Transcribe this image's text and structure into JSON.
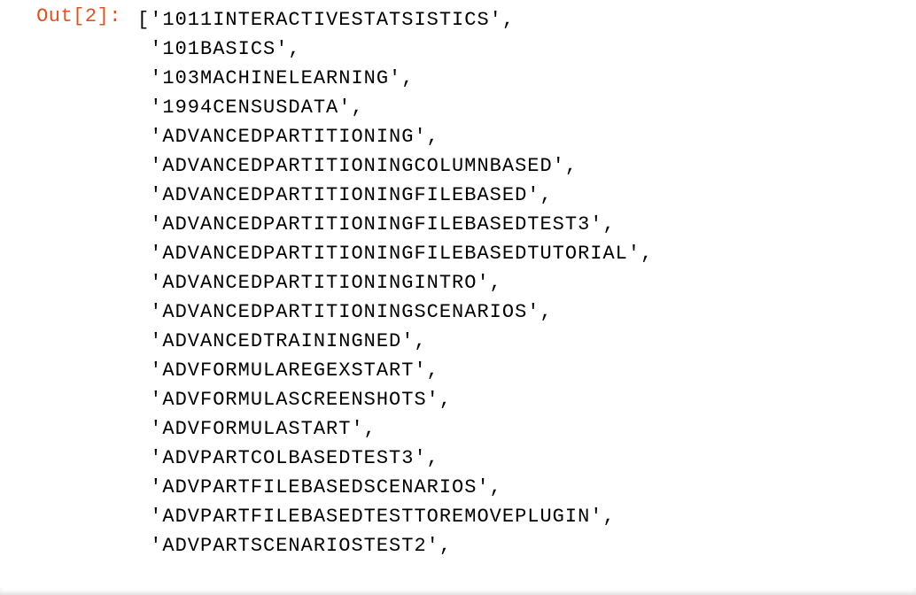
{
  "cell": {
    "prompt_label": "Out[2]:",
    "open_bracket": "[",
    "items": [
      "'1011INTERACTIVESTATSISTICS',",
      "'101BASICS',",
      "'103MACHINELEARNING',",
      "'1994CENSUSDATA',",
      "'ADVANCEDPARTITIONING',",
      "'ADVANCEDPARTITIONINGCOLUMNBASED',",
      "'ADVANCEDPARTITIONINGFILEBASED',",
      "'ADVANCEDPARTITIONINGFILEBASEDTEST3',",
      "'ADVANCEDPARTITIONINGFILEBASEDTUTORIAL',",
      "'ADVANCEDPARTITIONINGINTRO',",
      "'ADVANCEDPARTITIONINGSCENARIOS',",
      "'ADVANCEDTRAININGNED',",
      "'ADVFORMULAREGEXSTART',",
      "'ADVFORMULASCREENSHOTS',",
      "'ADVFORMULASTART',",
      "'ADVPARTCOLBASEDTEST3',",
      "'ADVPARTFILEBASEDSCENARIOS',",
      "'ADVPARTFILEBASEDTESTTOREMOVEPLUGIN',",
      "'ADVPARTSCENARIOSTEST2',"
    ]
  }
}
